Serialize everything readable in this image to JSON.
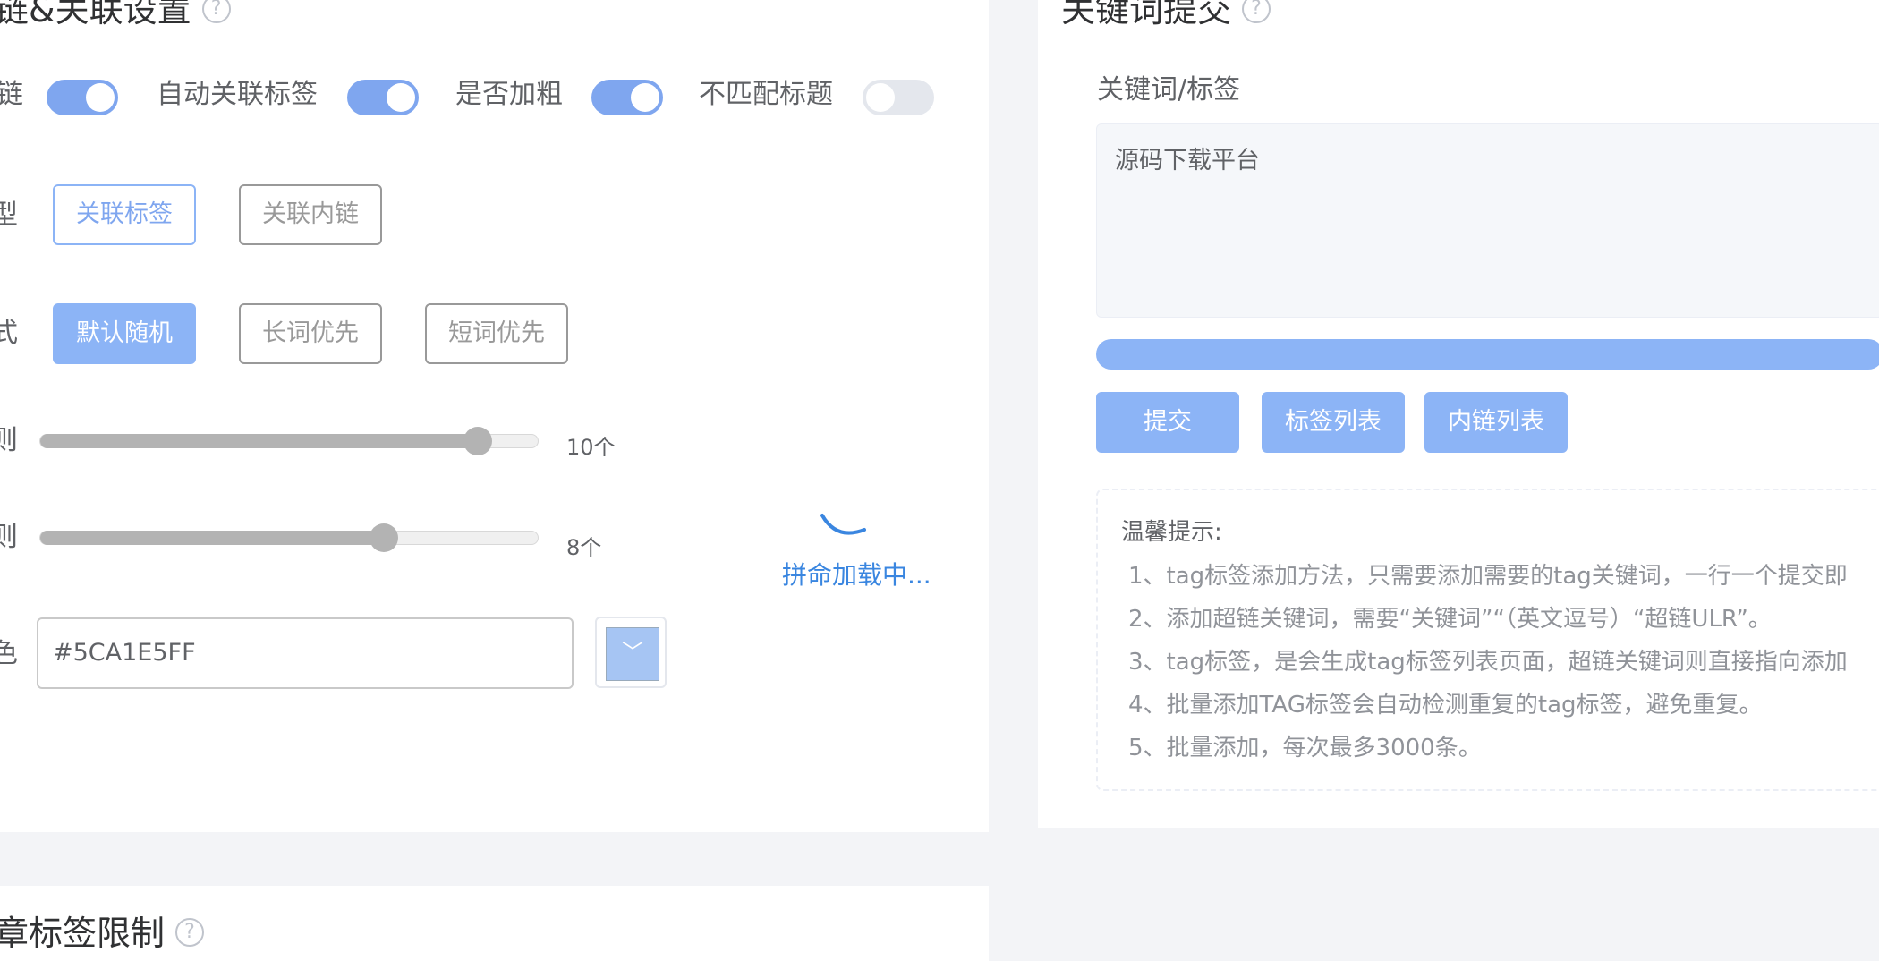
{
  "left_section": {
    "title": "链&关联设置",
    "switches": [
      {
        "label": "链",
        "on": true
      },
      {
        "label": "自动关联标签",
        "on": true
      },
      {
        "label": "是否加粗",
        "on": true
      },
      {
        "label": "不匹配标题",
        "on": false
      }
    ],
    "type_label": "型",
    "type_options": [
      "关联标签",
      "关联内链"
    ],
    "mode_label": "式",
    "mode_options": [
      "默认随机",
      "长词优先",
      "短词优先"
    ],
    "limit1_label": "则",
    "limit1_value": "10个",
    "limit1_fill_fraction": 0.88,
    "limit2_label": "则",
    "limit2_value": "8个",
    "limit2_fill_fraction": 0.69,
    "color_label": "色",
    "color_value": "#5CA1E5FF",
    "loading_text": "拼命加载中..."
  },
  "right_section": {
    "title": "关键词提交",
    "field_label": "关键词/标签",
    "textarea_value": "源码下载平台",
    "progress_fraction": 1.0,
    "buttons": {
      "submit": "提交",
      "tag_list": "标签列表",
      "link_list": "内链列表"
    },
    "tips_title": "温馨提示:",
    "tips": [
      "1、tag标签添加方法，只需要添加需要的tag关键词，一行一个提交即",
      "2、添加超链关键词，需要“关键词”“（英文逗号）“超链ULR”。",
      "3、tag标签，是会生成tag标签列表页面，超链关键词则直接指向添加",
      "4、批量添加TAG标签会自动检测重复的tag标签，避免重复。",
      "5、批量添加，每次最多3000条。"
    ]
  },
  "bottom_section": {
    "title": "章标签限制"
  },
  "icons": {
    "help": "?",
    "dropdown": "﹀"
  }
}
